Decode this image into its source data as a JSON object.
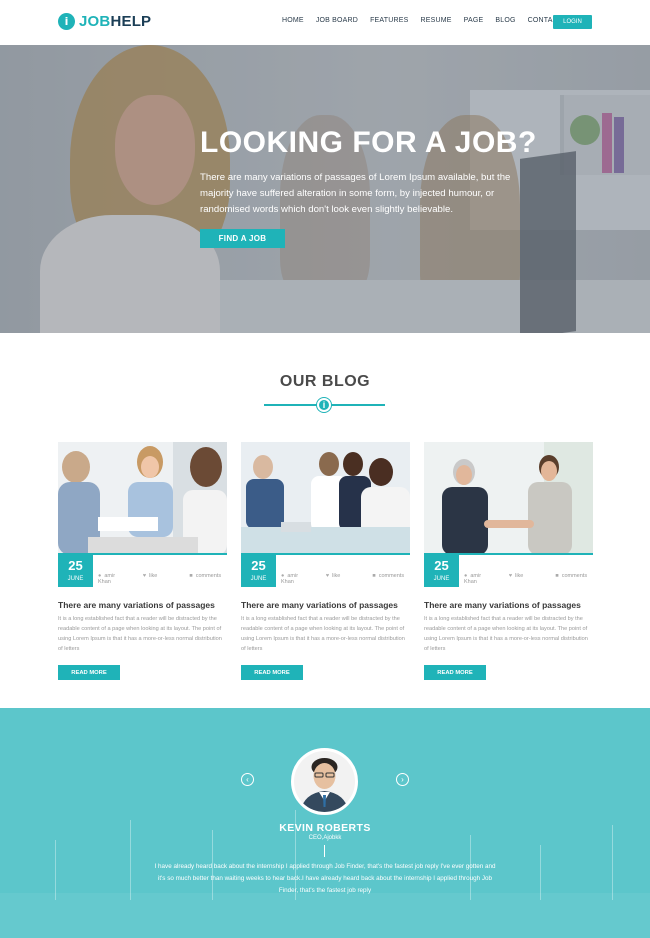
{
  "header": {
    "logo_mark": "i",
    "logo_part1": "JOB",
    "logo_part2": "HELP",
    "nav": [
      "HOME",
      "JOB BOARD",
      "FEATURES",
      "RESUME",
      "PAGE",
      "BLOG",
      "CONTACT"
    ],
    "login_label": "LOGIN"
  },
  "hero": {
    "title": "LOOKING FOR A JOB?",
    "text": "There are many variations of passages of Lorem Ipsum available, but the majority have suffered alteration in some form, by injected humour, or randomised words which don't look even slightly believable.",
    "button_label": "FIND A JOB"
  },
  "blog": {
    "title": "OUR BLOG",
    "divider_icon": "i",
    "posts": [
      {
        "day": "25",
        "month": "JUNE",
        "author": "amir Khan",
        "likes": "like",
        "comments": "comments",
        "title": "There are many variations of passages",
        "text": "It is a long established fact that a reader will be distracted by the readable content of a page when looking at its layout. The point of using Lorem Ipsum is that it has a more-or-less normal distribution of letters",
        "button_label": "READ MORE"
      },
      {
        "day": "25",
        "month": "JUNE",
        "author": "amir Khan",
        "likes": "like",
        "comments": "comments",
        "title": "There are many variations of passages",
        "text": "It is a long established fact that a reader will be distracted by the readable content of a page when looking at its layout. The point of using Lorem Ipsum is that it has a more-or-less normal distribution of letters",
        "button_label": "READ MORE"
      },
      {
        "day": "25",
        "month": "JUNE",
        "author": "amir Khan",
        "likes": "like",
        "comments": "comments",
        "title": "There are many variations of passages",
        "text": "It is a long established fact that a reader will be distracted by the readable content of a page when looking at its layout. The point of using Lorem Ipsum is that it has a more-or-less normal distribution of letters",
        "button_label": "READ MORE"
      }
    ]
  },
  "testimonial": {
    "prev_arrow": "‹",
    "next_arrow": "›",
    "name": "KEVIN ROBERTS",
    "role": "CEO,Ajobkk",
    "text": "I have already heard back about the internship I applied through Job Finder, that's the fastest job reply I've ever gotten and it's so much better than waiting weeks to hear back.I have already heard back about the internship I applied through Job Finder, that's the fastest job reply"
  },
  "icons": {
    "author": "user-icon",
    "like": "heart-icon",
    "comments": "comment-icon"
  },
  "colors": {
    "accent": "#1fb3b8",
    "navy": "#1b3e56",
    "testimonial_bg": "#5cc6cb"
  }
}
